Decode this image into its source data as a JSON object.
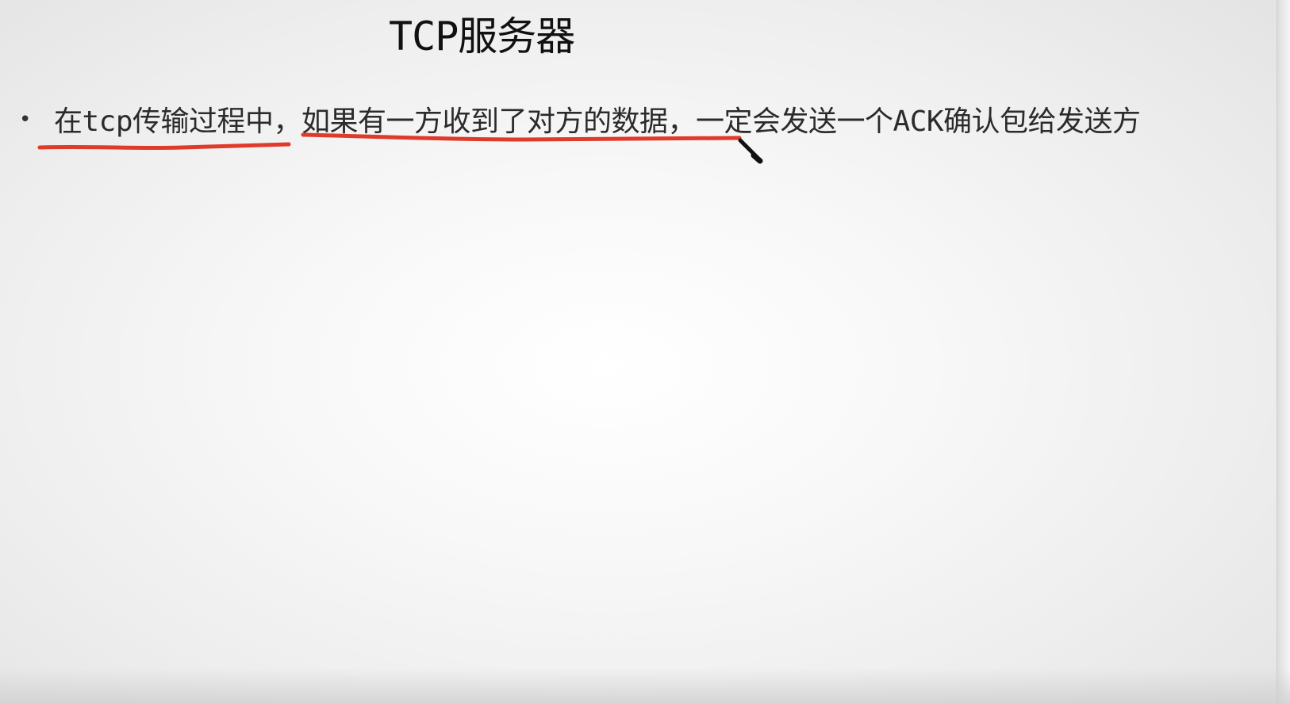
{
  "slide": {
    "title": "TCP服务器",
    "bullets": [
      {
        "text": "在tcp传输过程中，如果有一方收到了对方的数据，一定会发送一个ACK确认包给发送方"
      }
    ]
  },
  "annotation": {
    "underline_color": "#e03a2a",
    "pen_color": "#111111"
  },
  "icons": [
    "pen-cursor-icon"
  ]
}
